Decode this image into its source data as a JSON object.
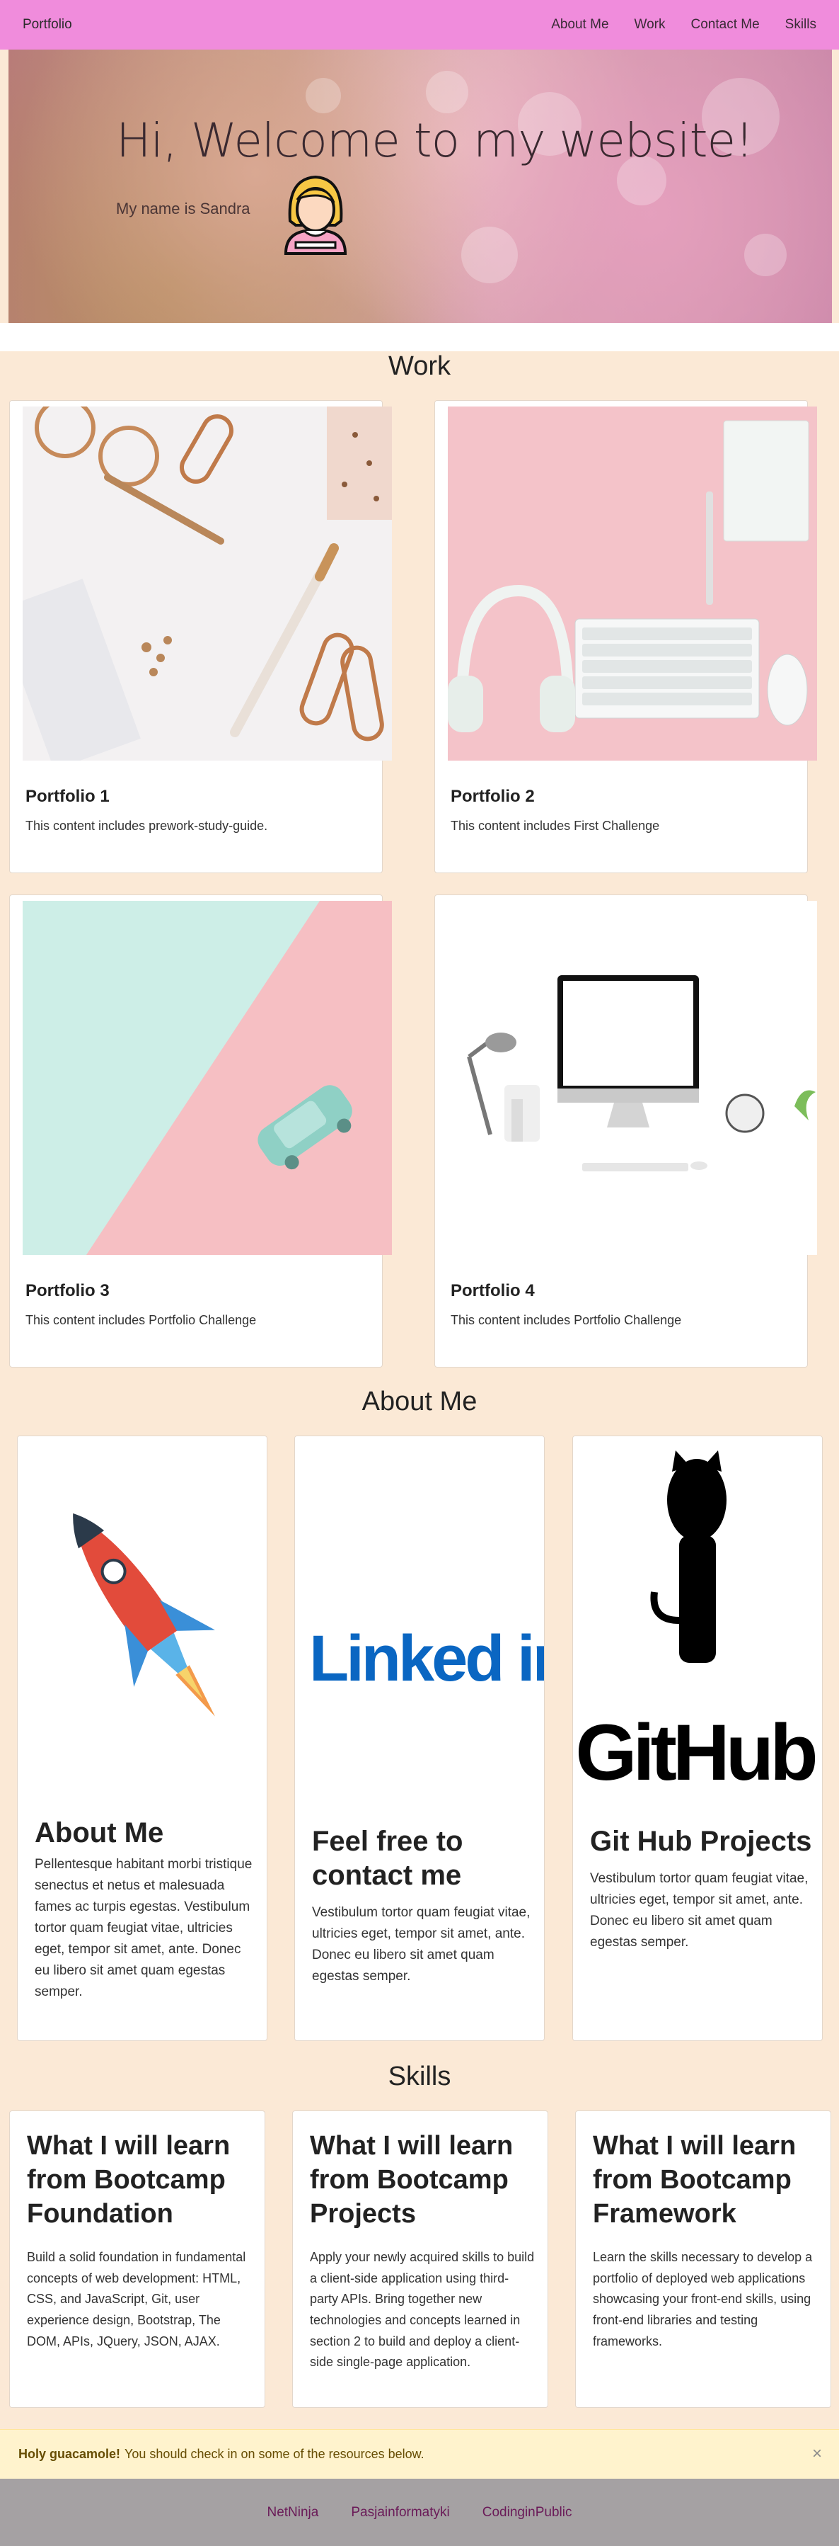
{
  "navbar": {
    "brand": "Portfolio",
    "links": [
      "About Me",
      "Work",
      "Contact Me",
      "Skills"
    ]
  },
  "hero": {
    "title": "Hi, Welcome to my website!",
    "subtitle": "My name is Sandra"
  },
  "work": {
    "heading": "Work",
    "cards": [
      {
        "title": "Portfolio 1",
        "text": "This content includes prework-study-guide."
      },
      {
        "title": "Portfolio 2",
        "text": "This content includes First Challenge"
      },
      {
        "title": "Portfolio 3",
        "text": "This content includes Portfolio Challenge"
      },
      {
        "title": "Portfolio 4",
        "text": "This content includes Portfolio Challenge"
      }
    ]
  },
  "about": {
    "heading": "About Me",
    "cards": [
      {
        "title": "About Me",
        "text": "Pellentesque habitant morbi tristique senectus et netus et malesuada fames ac turpis egestas. Vestibulum tortor quam feugiat vitae, ultricies eget, tempor sit amet, ante. Donec eu libero sit amet quam egestas semper."
      },
      {
        "title": "Feel free to contact me",
        "logo": "Linked in",
        "text": "Vestibulum tortor quam feugiat vitae, ultricies eget, tempor sit amet, ante. Donec eu libero sit amet quam egestas semper."
      },
      {
        "title": "Git Hub Projects",
        "logo": "GitHub",
        "text": "Vestibulum tortor quam feugiat vitae, ultricies eget, tempor sit amet, ante. Donec eu libero sit amet quam egestas semper."
      }
    ]
  },
  "skills": {
    "heading": "Skills",
    "cards": [
      {
        "title": "What I will learn from Bootcamp Foundation",
        "text": "Build a solid foundation in fundamental concepts of web development: HTML, CSS, and JavaScript, Git, user experience design, Bootstrap, The DOM, APIs, JQuery, JSON, AJAX."
      },
      {
        "title": "What I will learn from Bootcamp Projects",
        "text": "Apply your newly acquired skills to build a client-side application using third-party APIs. Bring together new technologies and concepts learned in section 2 to build and deploy a client-side single-page application."
      },
      {
        "title": "What I will learn from Bootcamp Framework",
        "text": "Learn the skills necessary to develop a portfolio of deployed web applications showcasing your front-end skills, using front-end libraries and testing frameworks."
      }
    ]
  },
  "alert": {
    "strong": "Holy guacamole!",
    "text": "You should check in on some of the resources below.",
    "close": "×"
  },
  "footer": {
    "links": [
      "NetNinja",
      "Pasjainformatyki",
      "CodinginPublic"
    ]
  },
  "colors": {
    "navbar": "#f08cdc",
    "page_bg": "#fbe9d6",
    "alert_bg": "#fff3cd",
    "footer_bg": "#a5a1a3",
    "footer_link": "#6a1a58"
  }
}
